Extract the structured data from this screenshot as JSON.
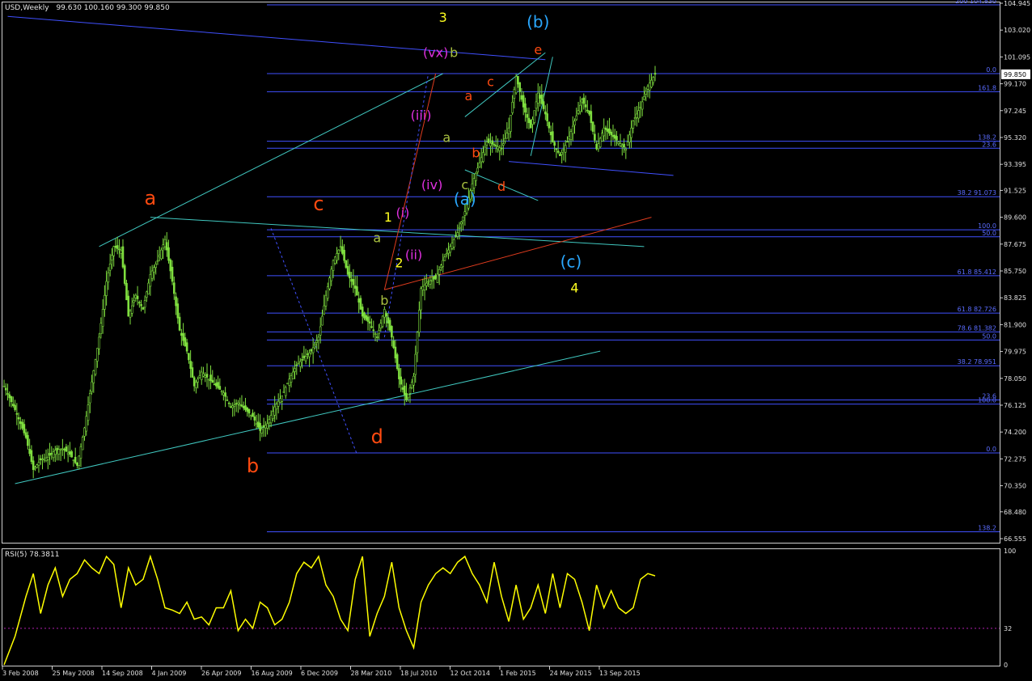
{
  "window": {
    "symbol_label": "USD,Weekly",
    "ohlc_text": "99.630 100.160 99.300 99.850",
    "current_price": "99.850",
    "rsi_label": "RSI(5) 78.3811"
  },
  "colors": {
    "background": "#000000",
    "candles": "#7fdf3f",
    "channel_lines": "#40c8c0",
    "fib_lines": "#4050ff",
    "red_line": "#e03c1e",
    "rsi_line": "#ffff00",
    "wave_red": "#ff4a10",
    "wave_yellow": "#ffff20",
    "wave_magenta": "#e030e0",
    "wave_cyan": "#2aa8ff",
    "wave_olive": "#a8c040"
  },
  "chart_data": [
    {
      "type": "candlestick",
      "name": "USD,Weekly",
      "ylim": [
        66.555,
        104.945
      ],
      "y_ticks": [
        "104.945",
        "103.020",
        "101.095",
        "99.170",
        "97.245",
        "95.320",
        "93.395",
        "91.525",
        "89.600",
        "87.675",
        "85.750",
        "83.825",
        "81.900",
        "79.975",
        "78.050",
        "76.125",
        "74.200",
        "72.275",
        "70.350",
        "68.480",
        "66.555"
      ],
      "x_ticks": [
        "3 Feb 2008",
        "25 May 2008",
        "14 Sep 2008",
        "4 Jan 2009",
        "26 Apr 2009",
        "16 Aug 2009",
        "6 Dec 2009",
        "28 Mar 2010",
        "18 Jul 2010",
        "12 Oct 2014",
        "1 Feb 2015",
        "24 May 2015",
        "13 Sep 2015"
      ],
      "close_path": [
        [
          0,
          77.5
        ],
        [
          3,
          75.8
        ],
        [
          6,
          73.8
        ],
        [
          8,
          71.5
        ],
        [
          10,
          72.2
        ],
        [
          12,
          72.4
        ],
        [
          14,
          72.9
        ],
        [
          16,
          73.0
        ],
        [
          18,
          72.6
        ],
        [
          20,
          71.8
        ],
        [
          22,
          74.5
        ],
        [
          24,
          77.8
        ],
        [
          26,
          81.0
        ],
        [
          28,
          85.0
        ],
        [
          30,
          87.5
        ],
        [
          32,
          87.2
        ],
        [
          34,
          82.5
        ],
        [
          36,
          84.0
        ],
        [
          38,
          83.0
        ],
        [
          40,
          85.5
        ],
        [
          42,
          86.5
        ],
        [
          44,
          88.0
        ],
        [
          46,
          85.0
        ],
        [
          48,
          81.5
        ],
        [
          50,
          80.0
        ],
        [
          52,
          77.5
        ],
        [
          54,
          78.5
        ],
        [
          56,
          78.0
        ],
        [
          58,
          77.5
        ],
        [
          60,
          77.0
        ],
        [
          62,
          76.0
        ],
        [
          64,
          76.3
        ],
        [
          66,
          75.8
        ],
        [
          68,
          75.3
        ],
        [
          70,
          74.3
        ],
        [
          72,
          74.8
        ],
        [
          74,
          76.0
        ],
        [
          76,
          76.8
        ],
        [
          78,
          78.0
        ],
        [
          80,
          79.0
        ],
        [
          82,
          79.5
        ],
        [
          84,
          80.0
        ],
        [
          86,
          81.0
        ],
        [
          88,
          84.0
        ],
        [
          90,
          86.5
        ],
        [
          92,
          87.5
        ],
        [
          94,
          85.5
        ],
        [
          96,
          84.5
        ],
        [
          98,
          82.5
        ],
        [
          100,
          82.0
        ],
        [
          102,
          81.0
        ],
        [
          104,
          83.0
        ],
        [
          106,
          81.0
        ],
        [
          108,
          78.0
        ],
        [
          110,
          76.5
        ],
        [
          112,
          78.2
        ],
        [
          114,
          84.5
        ],
        [
          116,
          85.0
        ],
        [
          118,
          85.2
        ],
        [
          120,
          86.5
        ],
        [
          122,
          87.5
        ],
        [
          124,
          88.5
        ],
        [
          126,
          90.0
        ],
        [
          128,
          92.0
        ],
        [
          130,
          93.5
        ],
        [
          132,
          95.0
        ],
        [
          134,
          94.8
        ],
        [
          136,
          94.5
        ],
        [
          138,
          96.0
        ],
        [
          140,
          99.7
        ],
        [
          142,
          97.5
        ],
        [
          144,
          96.0
        ],
        [
          146,
          98.5
        ],
        [
          148,
          97.0
        ],
        [
          150,
          95.0
        ],
        [
          152,
          94.0
        ],
        [
          154,
          95.0
        ],
        [
          156,
          96.5
        ],
        [
          158,
          98.0
        ],
        [
          160,
          97.0
        ],
        [
          162,
          94.5
        ],
        [
          164,
          96.0
        ],
        [
          166,
          95.5
        ],
        [
          168,
          95.0
        ],
        [
          170,
          94.5
        ],
        [
          172,
          96.5
        ],
        [
          174,
          97.5
        ],
        [
          176,
          99.0
        ],
        [
          178,
          99.85
        ]
      ],
      "horizontal_levels": [
        {
          "price": 104.83,
          "label": "200 104.830"
        },
        {
          "price": 99.9,
          "label": "0.0"
        },
        {
          "price": 98.6,
          "label": "161.8"
        },
        {
          "price": 95.05,
          "label": "138.2"
        },
        {
          "price": 94.55,
          "label": "23.6"
        },
        {
          "price": 91.073,
          "label": "38.2 91.073"
        },
        {
          "price": 88.7,
          "label": "100.0"
        },
        {
          "price": 88.2,
          "label": "50.0"
        },
        {
          "price": 85.412,
          "label": "61.8 85.412"
        },
        {
          "price": 82.726,
          "label": "61.8 82.726"
        },
        {
          "price": 81.382,
          "label": "78.6 81.382"
        },
        {
          "price": 80.8,
          "label": "50.0"
        },
        {
          "price": 78.951,
          "label": "38.2 78.951"
        },
        {
          "price": 76.5,
          "label": "23.6"
        },
        {
          "price": 76.2,
          "label": "100.0"
        },
        {
          "price": 72.7,
          "label": "0.0"
        },
        {
          "price": 67.05,
          "label": "138.2"
        }
      ],
      "wave_labels": [
        {
          "text": "a",
          "color": "wave_red",
          "x": 40,
          "price": 90.5
        },
        {
          "text": "b",
          "color": "wave_red",
          "x": 68,
          "price": 71.3
        },
        {
          "text": "c",
          "color": "wave_red",
          "x": 86,
          "price": 90.1
        },
        {
          "text": "d",
          "color": "wave_red",
          "x": 102,
          "price": 73.4
        },
        {
          "text": "3",
          "color": "wave_yellow",
          "x": 120,
          "price": 103.6
        },
        {
          "text": "(vx)",
          "color": "wave_magenta",
          "x": 118,
          "price": 101.1
        },
        {
          "text": "b",
          "color": "wave_olive",
          "x": 123,
          "price": 101.1
        },
        {
          "text": "(iii)",
          "color": "wave_magenta",
          "x": 114,
          "price": 96.6
        },
        {
          "text": "a",
          "color": "wave_olive",
          "x": 121,
          "price": 95.0
        },
        {
          "text": "(iv)",
          "color": "wave_magenta",
          "x": 117,
          "price": 91.6
        },
        {
          "text": "c",
          "color": "wave_olive",
          "x": 126,
          "price": 91.6
        },
        {
          "text": "(a)",
          "color": "wave_cyan",
          "x": 126,
          "price": 90.5
        },
        {
          "text": "(i)",
          "color": "wave_magenta",
          "x": 109,
          "price": 89.6
        },
        {
          "text": "1",
          "color": "wave_yellow",
          "x": 105,
          "price": 89.3
        },
        {
          "text": "a",
          "color": "wave_olive",
          "x": 102,
          "price": 87.8
        },
        {
          "text": "(ii)",
          "color": "wave_magenta",
          "x": 112,
          "price": 86.6
        },
        {
          "text": "2",
          "color": "wave_yellow",
          "x": 108,
          "price": 86.0
        },
        {
          "text": "b",
          "color": "wave_olive",
          "x": 104,
          "price": 83.3
        },
        {
          "text": "a",
          "color": "wave_red",
          "x": 127,
          "price": 98.0
        },
        {
          "text": "c",
          "color": "wave_red",
          "x": 133,
          "price": 99.0
        },
        {
          "text": "b",
          "color": "wave_red",
          "x": 129,
          "price": 93.9
        },
        {
          "text": "d",
          "color": "wave_red",
          "x": 136,
          "price": 91.5
        },
        {
          "text": "e",
          "color": "wave_red",
          "x": 146,
          "price": 101.3
        },
        {
          "text": "(b)",
          "color": "wave_cyan",
          "x": 146,
          "price": 103.2
        },
        {
          "text": "(c)",
          "color": "wave_cyan",
          "x": 155,
          "price": 86.0
        },
        {
          "text": "4",
          "color": "wave_yellow",
          "x": 156,
          "price": 84.2
        }
      ]
    },
    {
      "type": "line",
      "name": "RSI(5)",
      "ylim": [
        0,
        100
      ],
      "y_ticks": [
        "100",
        "32",
        "0"
      ],
      "reference_level": 32,
      "x": [
        0,
        3,
        6,
        8,
        10,
        12,
        14,
        16,
        18,
        20,
        22,
        24,
        26,
        28,
        30,
        32,
        34,
        36,
        38,
        40,
        42,
        44,
        46,
        48,
        50,
        52,
        54,
        56,
        58,
        60,
        62,
        64,
        66,
        68,
        70,
        72,
        74,
        76,
        78,
        80,
        82,
        84,
        86,
        88,
        90,
        92,
        94,
        96,
        98,
        100,
        102,
        104,
        106,
        108,
        110,
        112,
        114,
        116,
        118,
        120,
        122,
        124,
        126,
        128,
        130,
        132,
        134,
        136,
        138,
        140,
        142,
        144,
        146,
        148,
        150,
        152,
        154,
        156,
        158,
        160,
        162,
        164,
        166,
        168,
        170,
        172,
        174,
        176,
        178
      ],
      "values": [
        0,
        25,
        60,
        80,
        45,
        70,
        85,
        60,
        75,
        80,
        92,
        85,
        80,
        95,
        88,
        50,
        85,
        70,
        75,
        95,
        75,
        50,
        48,
        45,
        55,
        40,
        42,
        35,
        50,
        50,
        65,
        30,
        40,
        32,
        55,
        50,
        35,
        40,
        55,
        80,
        90,
        85,
        95,
        70,
        60,
        40,
        30,
        75,
        95,
        25,
        45,
        60,
        90,
        50,
        30,
        15,
        55,
        70,
        80,
        85,
        80,
        90,
        95,
        80,
        70,
        55,
        90,
        60,
        38,
        70,
        40,
        50,
        70,
        45,
        80,
        50,
        80,
        75,
        55,
        30,
        70,
        50,
        65,
        50,
        45,
        50,
        75,
        80,
        78
      ]
    }
  ]
}
